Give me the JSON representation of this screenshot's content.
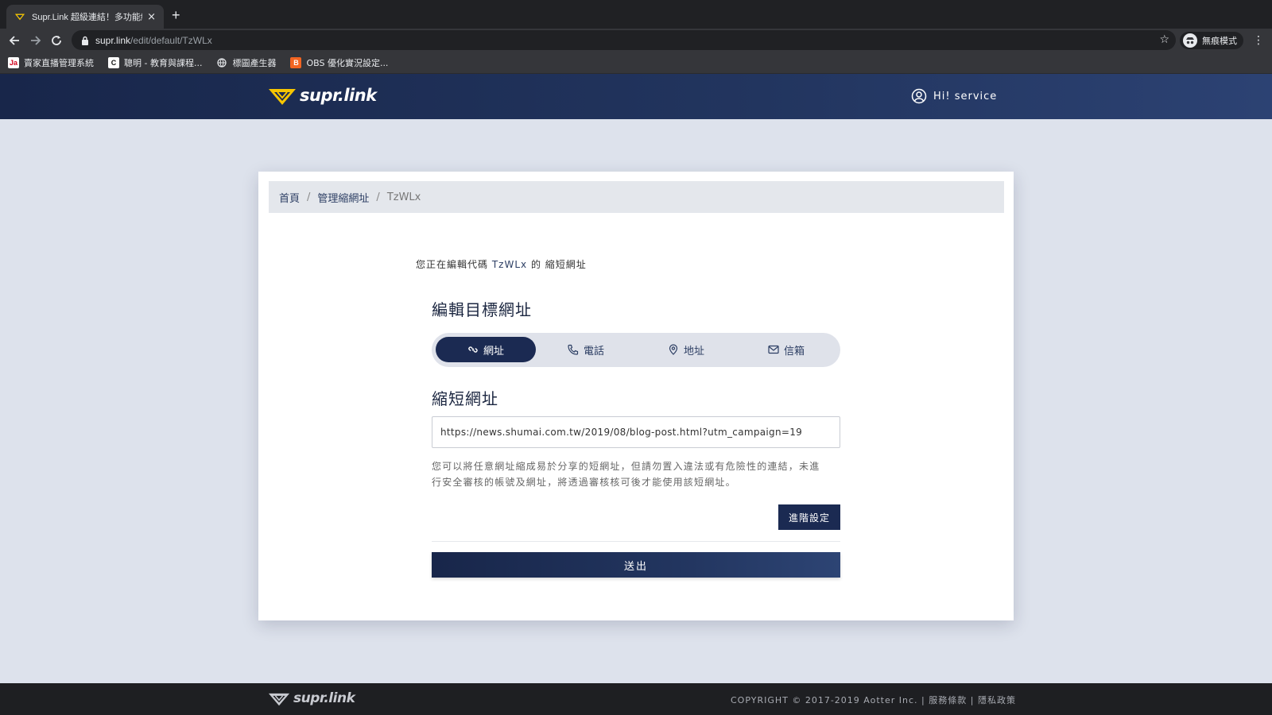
{
  "browser": {
    "tab_title": "Supr.Link 超級連結！多功能縮址",
    "tab_close": "×",
    "new_tab": "+",
    "url_host": "supr.link",
    "url_path": "/edit/default/TzWLx",
    "star": "☆",
    "incognito_label": "無痕模式",
    "menu": "⋮",
    "bookmarks": [
      {
        "label": "賣家直播管理系統",
        "icon_text": "Ja",
        "icon_bg": "#ffffff",
        "icon_color": "#d0021b"
      },
      {
        "label": "聰明 - 教育與課程...",
        "icon_text": "C",
        "icon_bg": "#ffffff",
        "icon_color": "#111111"
      },
      {
        "label": "標圖產生器",
        "icon_text": "",
        "icon_bg": "#35363a",
        "icon_color": "#e8eaed"
      },
      {
        "label": "OBS 優化實況設定...",
        "icon_text": "B",
        "icon_bg": "#f26522",
        "icon_color": "#ffffff"
      }
    ]
  },
  "header": {
    "logo_text": "supr.link",
    "user_label": "Hi! service"
  },
  "breadcrumb": {
    "home": "首頁",
    "manage": "管理縮網址",
    "current": "TzWLx",
    "sep": "/"
  },
  "edit_note": {
    "prefix": "您正在編輯代碼",
    "code": "TzWLx",
    "suffix": "的 縮短網址"
  },
  "target_title": "編輯目標網址",
  "type_tabs": [
    {
      "label": "網址",
      "icon": "link-icon",
      "active": true
    },
    {
      "label": "電話",
      "icon": "phone-icon",
      "active": false
    },
    {
      "label": "地址",
      "icon": "map-pin-icon",
      "active": false
    },
    {
      "label": "信箱",
      "icon": "mail-icon",
      "active": false
    }
  ],
  "short_url_title": "縮短網址",
  "url_input_value": "https://news.shumai.com.tw/2019/08/blog-post.html?utm_campaign=19",
  "help_text": "您可以將任意網址縮成易於分享的短網址，但請勿置入違法或有危險性的連結，未進行安全審核的帳號及網址，將透過審核核可後才能使用該短網址。",
  "advanced_button": "進階設定",
  "submit_button": "送出",
  "footer": {
    "logo_text": "supr.link",
    "copyright": "COPYRIGHT © 2017-2019 Aotter Inc. |",
    "terms": " 服務條款",
    "sep": "|",
    "privacy": " 隱私政策"
  },
  "colors": {
    "brand_navy": "#1b2a52",
    "logo_yellow": "#f7c600",
    "page_bg": "#dde2ec"
  }
}
